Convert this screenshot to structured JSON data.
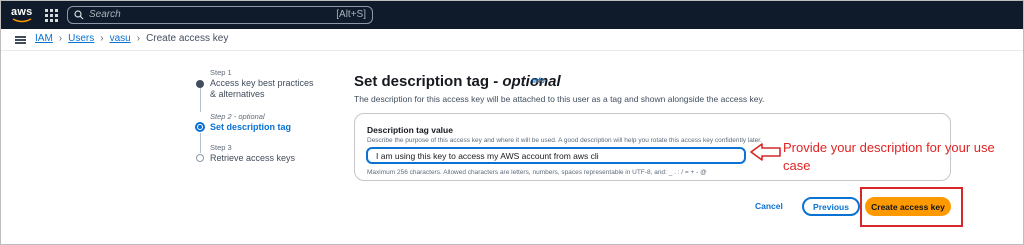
{
  "topnav": {
    "logo_text": "aws",
    "search_placeholder": "Search",
    "search_shortcut": "[Alt+S]"
  },
  "breadcrumb": {
    "items": [
      "IAM",
      "Users",
      "vasu"
    ],
    "current": "Create access key"
  },
  "steps": [
    {
      "label": "Step 1",
      "title": "Access key best practices & alternatives"
    },
    {
      "label": "Step 2 - optional",
      "title": "Set description tag"
    },
    {
      "label": "Step 3",
      "title": "Retrieve access keys"
    }
  ],
  "form": {
    "title_main": "Set description tag - ",
    "title_optional": "optional",
    "info_link": "Info",
    "description": "The description for this access key will be attached to this user as a tag and shown alongside the access key.",
    "field_label": "Description tag value",
    "field_description": "Describe the purpose of this access key and where it will be used. A good description will help you rotate this access key confidently later.",
    "field_value": "I am using this key to access my AWS account from aws cli",
    "field_hint": "Maximum 256 characters. Allowed characters are letters, numbers, spaces representable in UTF-8, and: _ . : / = + - @"
  },
  "annotation": {
    "text": "Provide your description for your use case",
    "color": "#e02424"
  },
  "buttons": {
    "cancel": "Cancel",
    "previous": "Previous",
    "create": "Create access key"
  },
  "colors": {
    "nav_bg": "#0f1b2a",
    "link": "#0972d3",
    "primary": "#ff9900",
    "highlight": "#d62828"
  }
}
